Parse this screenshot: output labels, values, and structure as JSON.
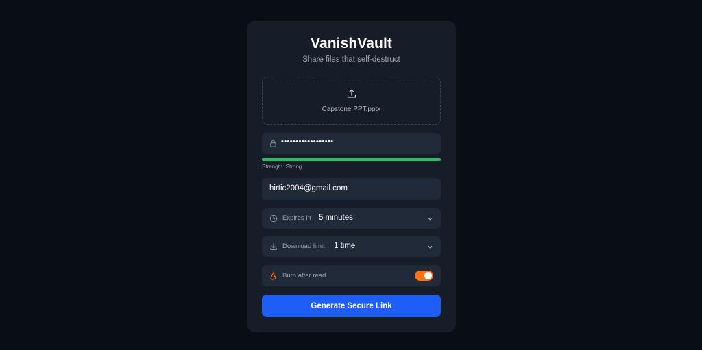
{
  "app": {
    "title": "VanishVault",
    "subtitle": "Share files that self-destruct"
  },
  "upload": {
    "icon": "upload-icon",
    "filename": "Capstone PPT.pptx"
  },
  "password": {
    "icon": "lock-icon",
    "masked_value": "••••••••••••••••••",
    "strength_label": "Strength: Strong",
    "strength_fraction": 1.0,
    "strength_color": "#21c45d"
  },
  "email": {
    "value": "hirtic2004@gmail.com"
  },
  "expires": {
    "icon": "clock-icon",
    "label": "Expires in",
    "value": "5 minutes"
  },
  "download_limit": {
    "icon": "download-icon",
    "label": "Download limit",
    "value": "1 time"
  },
  "burn": {
    "icon": "flame-icon",
    "label": "Burn after read",
    "enabled": true,
    "accent": "#f97316"
  },
  "submit": {
    "label": "Generate Secure Link",
    "color": "#1e5ef7"
  }
}
